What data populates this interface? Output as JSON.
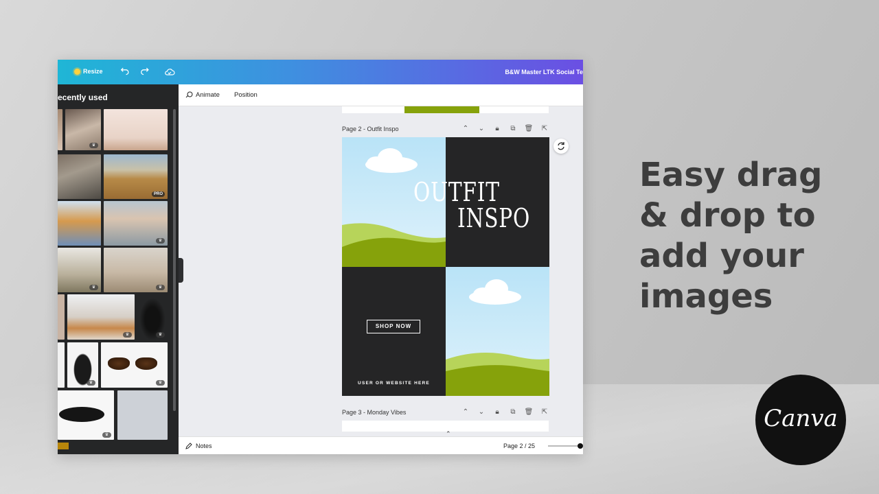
{
  "topbar": {
    "resize_label": "Resize",
    "doc_title": "B&W Master LTK Social Te"
  },
  "sidebar": {
    "heading": "ecently used",
    "thumbs": [
      {
        "badge": "crown"
      },
      {
        "badge": ""
      },
      {
        "badge": ""
      },
      {
        "badge": "PRO"
      },
      {
        "badge": ""
      },
      {
        "badge": "crown"
      },
      {
        "badge": "crown"
      },
      {
        "badge": "crown"
      },
      {
        "badge": "crown"
      },
      {
        "badge": "crown"
      },
      {
        "badge": "crown"
      },
      {
        "badge": "crown"
      },
      {
        "badge": "crown"
      },
      {
        "badge": ""
      }
    ]
  },
  "toolbar": {
    "animate_label": "Animate",
    "position_label": "Position"
  },
  "pages": {
    "page2_label": "Page 2 - Outfit Inspo",
    "page3_label": "Page 3 - Monday Vibes"
  },
  "design": {
    "title_line1": "OUTFIT",
    "title_line2": "INSPO",
    "button_label": "SHOP NOW",
    "site_text": "USER OR WEBSITE HERE",
    "colors": {
      "dark": "#252526",
      "green": "#86a20b",
      "sky": "#cdebf9"
    }
  },
  "bottombar": {
    "notes_label": "Notes",
    "page_counter": "Page 2 / 25"
  },
  "headline": {
    "line1": "Easy drag",
    "line2": "& drop to",
    "line3": "add your",
    "line4": "images"
  },
  "logo_text": "Canva"
}
